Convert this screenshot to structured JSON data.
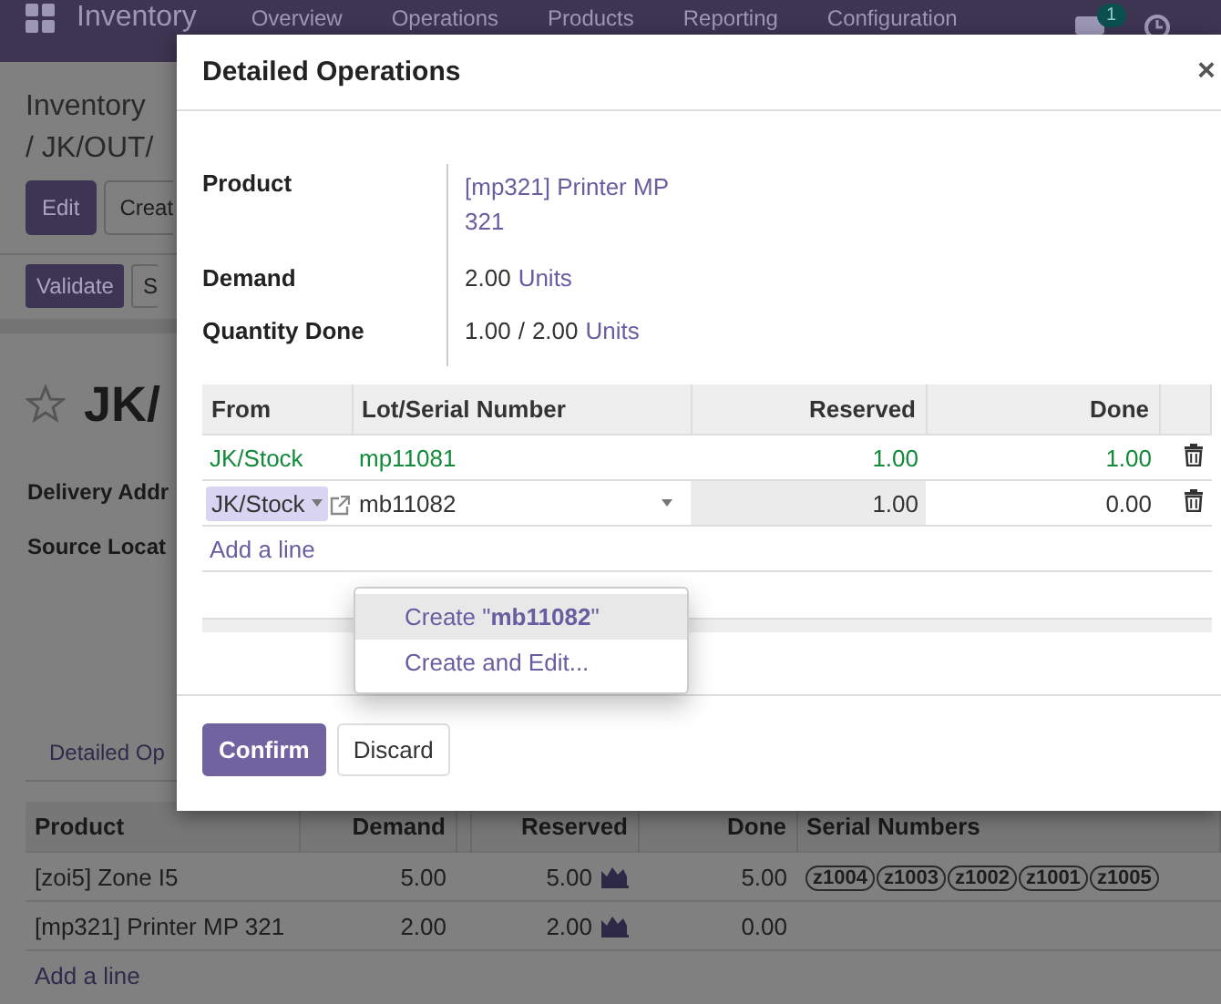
{
  "navbar": {
    "app_title": "Inventory",
    "menu": [
      "Overview",
      "Operations",
      "Products",
      "Reporting",
      "Configuration"
    ],
    "chat_badge": "1"
  },
  "breadcrumb": [
    "Inventory",
    "/ JK/OUT/"
  ],
  "actions": [
    "Edit",
    "Creat"
  ],
  "status_actions": [
    "Validate",
    "S"
  ],
  "record": {
    "starred": false,
    "title": "JK/",
    "fields": [
      "Delivery Addr",
      "Source Locat"
    ]
  },
  "page_tab": "Detailed Op",
  "moves": {
    "columns": [
      "Product",
      "Demand",
      "Reserved",
      "Done",
      "Serial Numbers"
    ],
    "rows": [
      {
        "product": "[zoi5] Zone I5",
        "demand": "5.00",
        "reserved": "5.00",
        "done": "5.00",
        "serials": [
          "z1004",
          "z1003",
          "z1002",
          "z1001",
          "z1005"
        ]
      },
      {
        "product": "[mp321] Printer MP 321",
        "demand": "2.00",
        "reserved": "2.00",
        "done": "0.00"
      }
    ],
    "add_line": "Add a line"
  },
  "dialog": {
    "title": "Detailed Operations",
    "close": "×",
    "fields": [
      {
        "kind": "link",
        "label": "Product",
        "value": "[mp321] Printer MP 321"
      },
      {
        "kind": "quantity",
        "label": "Demand",
        "value": "2.00",
        "unit": "Units"
      },
      {
        "kind": "progress",
        "label": "Quantity Done",
        "value": "1.00",
        "separator": "/",
        "total": "2.00",
        "unit": "Units"
      }
    ],
    "columns": [
      "From",
      "Lot/Serial Number",
      "Reserved",
      "Done"
    ],
    "lines": [
      {
        "kind": "done",
        "from": "JK/Stock",
        "lot": "mp11081",
        "reserved": "1.00",
        "done": "1.00"
      },
      {
        "kind": "editing",
        "from": "JK/Stock",
        "lot": "mb11082",
        "reserved": "1.00",
        "done": "0.00"
      }
    ],
    "add_line": "Add a line",
    "autocomplete": [
      {
        "text": "Create \"**mb11082**\"",
        "selected": true
      },
      {
        "text": "Create and Edit...",
        "selected": false
      }
    ],
    "buttons": [
      {
        "label": "Confirm",
        "primary": true
      },
      {
        "label": "Discard",
        "primary": false
      }
    ]
  }
}
